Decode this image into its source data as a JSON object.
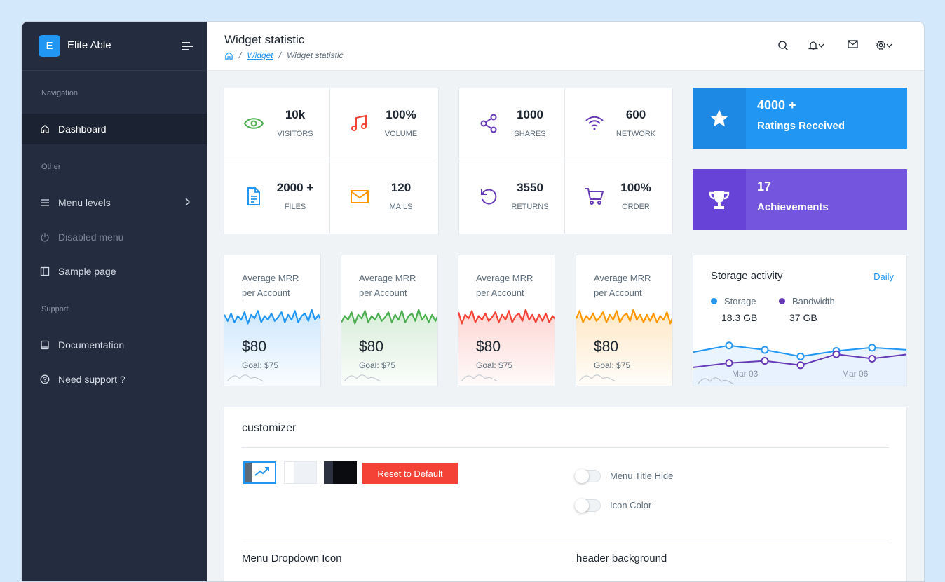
{
  "brand": {
    "logo_letter": "E",
    "name": "Elite Able"
  },
  "sidebar": {
    "captions": {
      "navigation": "Navigation",
      "other": "Other",
      "support": "Support"
    },
    "items": [
      {
        "label": "Dashboard",
        "icon": "home-icon",
        "active": true
      },
      {
        "label": "Menu levels",
        "icon": "menu-icon",
        "has_children": true
      },
      {
        "label": "Disabled menu",
        "icon": "power-icon",
        "disabled": true
      },
      {
        "label": "Sample page",
        "icon": "sidebar-layout-icon"
      },
      {
        "label": "Documentation",
        "icon": "book-icon"
      },
      {
        "label": "Need support ?",
        "icon": "help-circle-icon"
      }
    ]
  },
  "header": {
    "title": "Widget statistic",
    "breadcrumb": [
      "Widget",
      "Widget statistic"
    ],
    "icons": [
      "search-icon",
      "bell-icon",
      "mail-icon",
      "settings-icon"
    ]
  },
  "stats_left": [
    {
      "value": "10k",
      "label": "VISITORS",
      "icon": "eye-icon",
      "color": "#4caf50"
    },
    {
      "value": "100%",
      "label": "VOLUME",
      "icon": "music-icon",
      "color": "#f44336"
    },
    {
      "value": "2000 +",
      "label": "FILES",
      "icon": "file-icon",
      "color": "#2196f3"
    },
    {
      "value": "120",
      "label": "MAILS",
      "icon": "mail-icon",
      "color": "#ff9800"
    }
  ],
  "stats_right": [
    {
      "value": "1000",
      "label": "SHARES",
      "icon": "share-icon",
      "color": "#673ab7"
    },
    {
      "value": "600",
      "label": "NETWORK",
      "icon": "wifi-icon",
      "color": "#673ab7"
    },
    {
      "value": "3550",
      "label": "RETURNS",
      "icon": "rotate-icon",
      "color": "#673ab7"
    },
    {
      "value": "100%",
      "label": "ORDER",
      "icon": "cart-icon",
      "color": "#673ab7"
    }
  ],
  "highlight_cards": [
    {
      "value": "4000 +",
      "label": "Ratings Received",
      "icon": "star-icon",
      "color": "#2196f3"
    },
    {
      "value": "17",
      "label": "Achievements",
      "icon": "trophy-icon",
      "color": "#673ab7"
    }
  ],
  "mrr_cards": [
    {
      "title": "Average MRR per Account",
      "amount": "$80",
      "goal": "Goal: $75",
      "color": "#2196f3"
    },
    {
      "title": "Average MRR per Account",
      "amount": "$80",
      "goal": "Goal: $75",
      "color": "#4caf50"
    },
    {
      "title": "Average MRR per Account",
      "amount": "$80",
      "goal": "Goal: $75",
      "color": "#f44336"
    },
    {
      "title": "Average MRR per Account",
      "amount": "$80",
      "goal": "Goal: $75",
      "color": "#ff9800"
    }
  ],
  "storage": {
    "title": "Storage activity",
    "period": "Daily",
    "legend": [
      {
        "name": "Storage",
        "value": "18.3 GB",
        "color": "#2196f3"
      },
      {
        "name": "Bandwidth",
        "value": "37 GB",
        "color": "#673ab7"
      }
    ],
    "x_ticks": [
      "Mar 03",
      "Mar 06"
    ]
  },
  "customizer": {
    "title": "customizer",
    "reset_label": "Reset to Default",
    "toggles": [
      "Menu Title Hide",
      "Icon Color"
    ],
    "sections": [
      "Menu Dropdown Icon",
      "header background"
    ]
  },
  "chart_data": [
    {
      "type": "area",
      "title": "Storage activity",
      "series": [
        {
          "name": "Storage",
          "values": [
            32,
            38,
            34,
            28,
            33,
            36,
            34
          ]
        },
        {
          "name": "Bandwidth",
          "values": [
            18,
            22,
            24,
            20,
            30,
            26,
            30
          ]
        }
      ],
      "x_tick_labels": [
        "Mar 03",
        "Mar 06"
      ]
    }
  ]
}
